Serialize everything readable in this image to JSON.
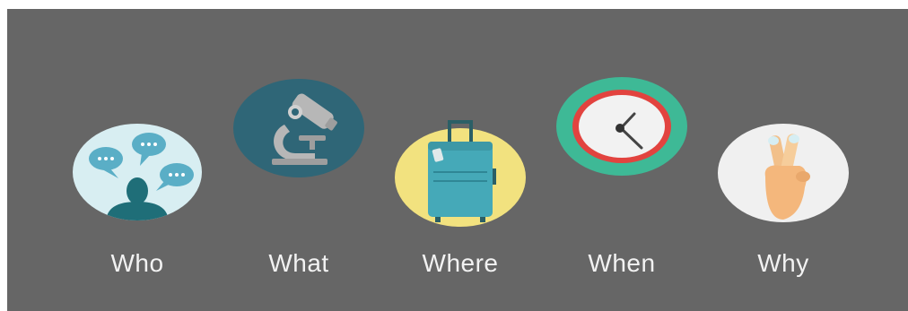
{
  "items": [
    {
      "label": "Who",
      "icon": "people-chat-icon",
      "circle_color": "#d8eef2"
    },
    {
      "label": "What",
      "icon": "microscope-icon",
      "circle_color": "#2f6677"
    },
    {
      "label": "Where",
      "icon": "suitcase-icon",
      "circle_color": "#f2e27f"
    },
    {
      "label": "When",
      "icon": "clock-icon",
      "circle_color": "#3eb996"
    },
    {
      "label": "Why",
      "icon": "crossed-fingers-icon",
      "circle_color": "#f0f0f0"
    }
  ],
  "colors": {
    "panel": "#666666",
    "label_text": "#f2f2f2"
  }
}
